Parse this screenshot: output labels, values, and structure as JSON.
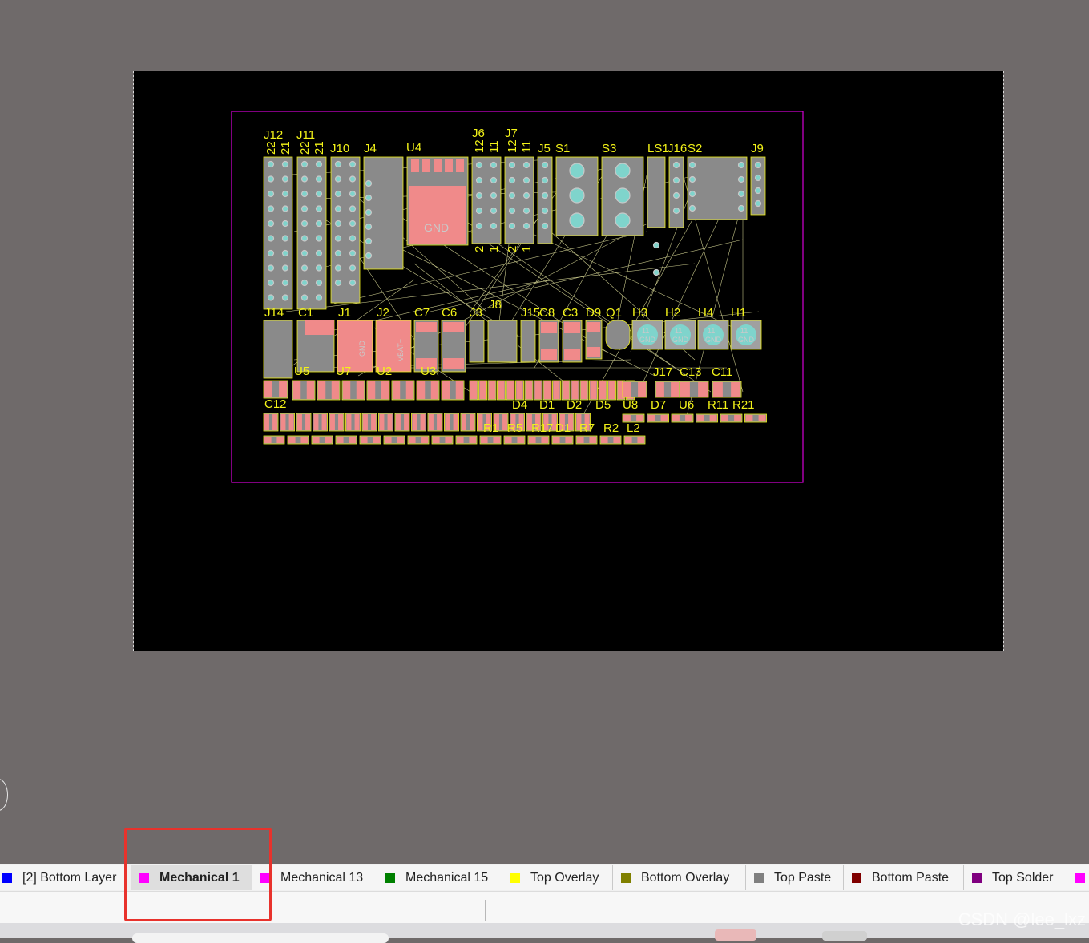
{
  "canvas": {
    "designators_row1": [
      "J12",
      "J11",
      "J10",
      "J4",
      "U4",
      "J6",
      "J7",
      "J5",
      "S1",
      "S3",
      "LS1",
      "J16",
      "S2",
      "J9"
    ],
    "designators_row2": [
      "C7",
      "C6",
      "J3",
      "J8",
      "J15",
      "C8",
      "C3",
      "D9",
      "Q1",
      "H3",
      "H2",
      "H4",
      "H1"
    ],
    "designators_row3": [
      "J17",
      "C13",
      "C11"
    ],
    "designators_row4": [
      "D4",
      "D1",
      "D2",
      "D5",
      "U8",
      "D7",
      "U6",
      "R11",
      "R21"
    ],
    "designators_row5": [
      "R1",
      "R5",
      "R17",
      "D1",
      "R7",
      "R2",
      "L2"
    ],
    "designators_misc": [
      "J1",
      "J2",
      "C1",
      "U7",
      "U2",
      "U3",
      "U5",
      "C12",
      "J14"
    ],
    "pin_numbers": [
      "22",
      "21",
      "22",
      "21",
      "12",
      "11",
      "12",
      "11",
      "2",
      "1",
      "2",
      "1"
    ],
    "net_labels": {
      "gnd": "GND",
      "vbat": "VBAT+",
      "hole_pin": "11"
    }
  },
  "layer_tabs": [
    {
      "label": "[2] Bottom Layer",
      "color": "#0000ff",
      "active": false
    },
    {
      "label": "Mechanical 1",
      "color": "#ff00ff",
      "active": true
    },
    {
      "label": "Mechanical 13",
      "color": "#ff00ff",
      "active": false
    },
    {
      "label": "Mechanical 15",
      "color": "#008000",
      "active": false
    },
    {
      "label": "Top Overlay",
      "color": "#ffff00",
      "active": false
    },
    {
      "label": "Bottom Overlay",
      "color": "#808000",
      "active": false
    },
    {
      "label": "Top Paste",
      "color": "#808080",
      "active": false
    },
    {
      "label": "Bottom Paste",
      "color": "#800000",
      "active": false
    },
    {
      "label": "Top Solder",
      "color": "#800080",
      "active": false
    },
    {
      "label": "",
      "color": "#ff00ff",
      "active": false
    }
  ],
  "colors": {
    "workspace": "#6f6a6a",
    "sheet": "#000000",
    "overlay": "#f2f218",
    "outline": "#d600d6",
    "pad_smd": "#f08a8a",
    "pad_body": "#888888",
    "pad_hole": "#7fd4cc",
    "highlight": "#e8322c"
  },
  "watermark": "CSDN @lee_lxz"
}
